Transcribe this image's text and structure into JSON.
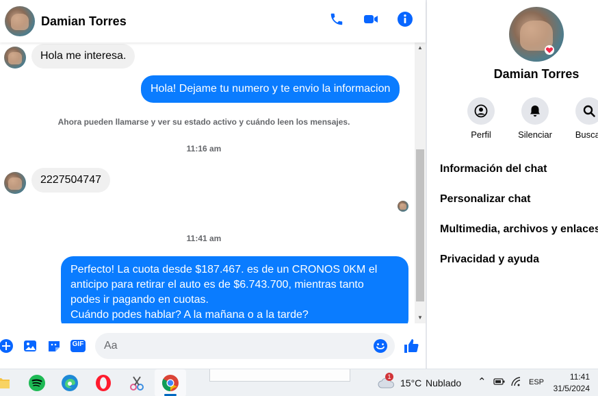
{
  "contact": {
    "name": "Damian Torres"
  },
  "messages": [
    {
      "dir": "in",
      "text": "Hola me interesa."
    },
    {
      "dir": "out",
      "text": "Hola! Dejame tu numero y te envio la informacion"
    },
    {
      "dir": "system",
      "text": "Ahora pueden llamarse y ver su estado activo y cuándo leen los mensajes."
    },
    {
      "dir": "time",
      "text": "11:16 am"
    },
    {
      "dir": "in",
      "text": "2227504747"
    },
    {
      "dir": "time",
      "text": "11:41 am"
    },
    {
      "dir": "out",
      "lines": [
        "Perfecto! La cuota desde $187.467. es de un CRONOS 0KM el",
        "anticipo para retirar el auto es de $6.743.700, mientras tanto",
        "podes ir pagando en cuotas.",
        "Cuándo podes hablar? A la mañana o a la tarde?"
      ]
    }
  ],
  "composer": {
    "placeholder": "Aa",
    "gif_label": "GIF"
  },
  "info_panel": {
    "actions": [
      {
        "label": "Perfil",
        "icon": "profile-icon"
      },
      {
        "label": "Silenciar",
        "icon": "bell-icon"
      },
      {
        "label": "Buscar",
        "icon": "search-icon"
      }
    ],
    "menu": [
      "Información del chat",
      "Personalizar chat",
      "Multimedia, archivos y enlaces",
      "Privacidad y ayuda"
    ]
  },
  "taskbar": {
    "weather_temp": "15°C",
    "weather_desc": "Nublado",
    "weather_alert": "1",
    "language": "ESP",
    "time": "11:41",
    "date": "31/5/2024"
  },
  "colors": {
    "accent": "#0a7cff",
    "bubble_in": "#f0f0f0",
    "icon_blue": "#0866ff"
  }
}
